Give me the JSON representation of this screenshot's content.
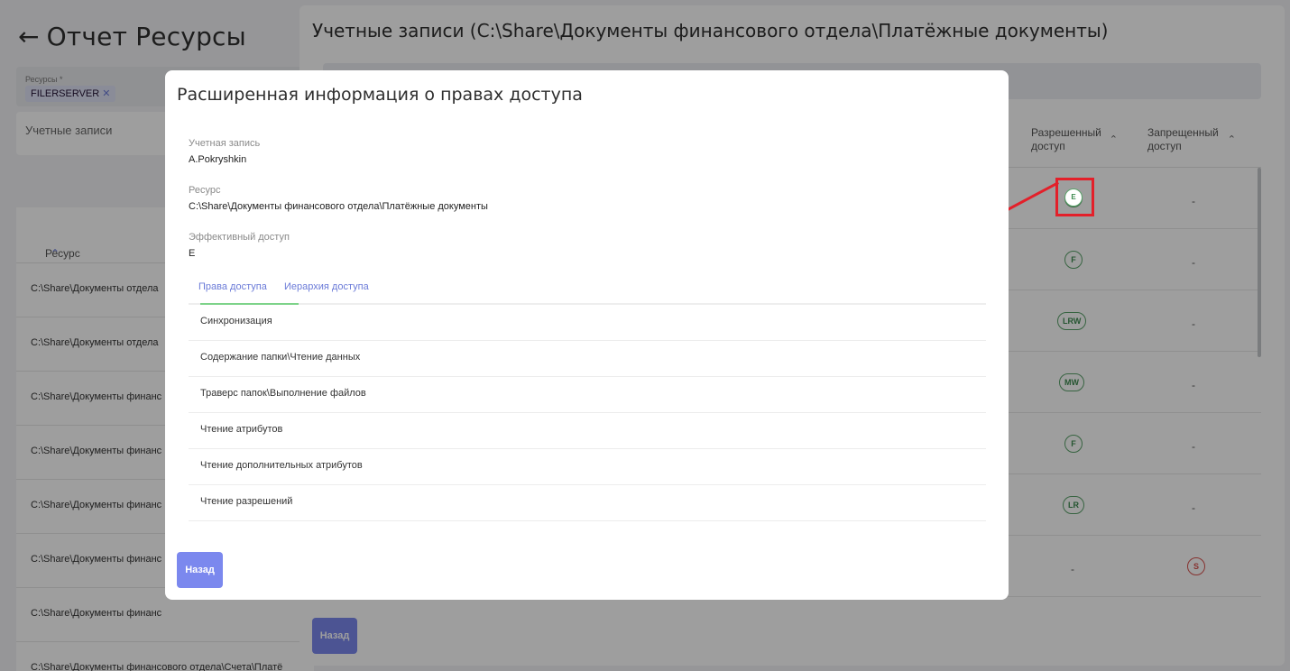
{
  "base": {
    "title": "Отчет Ресурсы",
    "back_arrow": "←",
    "filter_label": "Ресурсы *",
    "filter_chip": "FILERSERVER",
    "filter_chip_remove": "✕",
    "accounts_label": "Учетные записи",
    "table_header": "Ресурс",
    "sort_icon": "⌃",
    "rows": [
      "C:\\Share\\Документы отдела",
      "C:\\Share\\Документы отдела",
      "C:\\Share\\Документы финанс",
      "C:\\Share\\Документы финанс",
      "C:\\Share\\Документы финанс",
      "C:\\Share\\Документы финанс",
      "C:\\Share\\Документы финанс",
      "C:\\Share\\Документы финансового отдела\\Счета\\Платё"
    ]
  },
  "panel": {
    "title": "Учетные записи (C:\\Share\\Документы финансового отдела\\Платёжные документы)",
    "col_allowed": "Разрешенный доступ",
    "col_denied": "Запрещенный доступ",
    "sort_icon": "⌃",
    "rows": [
      {
        "allowed": "E",
        "denied": "-"
      },
      {
        "allowed": "F",
        "denied": "-"
      },
      {
        "allowed": "LRW",
        "denied": "-"
      },
      {
        "allowed": "MW",
        "denied": "-"
      },
      {
        "allowed": "F",
        "denied": "-"
      },
      {
        "allowed": "LR",
        "denied": "-"
      },
      {
        "allowed": "-",
        "denied": "S"
      }
    ],
    "back_label": "Назад",
    "colors": {
      "badge_green": "#5aa26a",
      "badge_red": "#d9534f",
      "accent": "#7b88ee"
    }
  },
  "modal": {
    "title": "Расширенная информация о правах доступа",
    "account_label": "Учетная запись",
    "account_value": "A.Pokryshkin",
    "resource_label": "Ресурс",
    "resource_value": "C:\\Share\\Документы финансового отдела\\Платёжные документы",
    "effective_label": "Эффективный доступ",
    "effective_value": "E",
    "tabs": [
      "Права доступа",
      "Иерархия доступа"
    ],
    "permissions": [
      "Синхронизация",
      "Содержание папки\\Чтение данных",
      "Траверс папок\\Выполнение файлов",
      "Чтение атрибутов",
      "Чтение дополнительных атрибутов",
      "Чтение разрешений"
    ],
    "back_label": "Назад"
  },
  "annotation": {
    "highlight_badge": "E",
    "color": "#e3202a"
  }
}
